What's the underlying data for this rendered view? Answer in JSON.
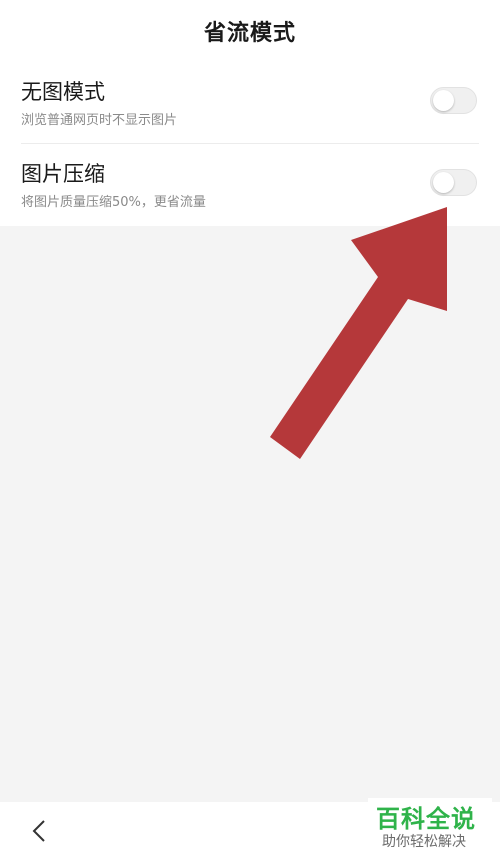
{
  "header": {
    "title": "省流模式"
  },
  "settings": [
    {
      "label": "无图模式",
      "description": "浏览普通网页时不显示图片",
      "enabled": false
    },
    {
      "label": "图片压缩",
      "description": "将图片质量压缩50%，更省流量",
      "enabled": false
    }
  ],
  "annotation": {
    "arrow_color": "#b5383a"
  },
  "bottom_bar": {
    "back_icon": "chevron-left-icon"
  },
  "watermark": {
    "title": "百科全说",
    "subtitle": "助你轻松解决",
    "title_color": "#2fb34a"
  }
}
